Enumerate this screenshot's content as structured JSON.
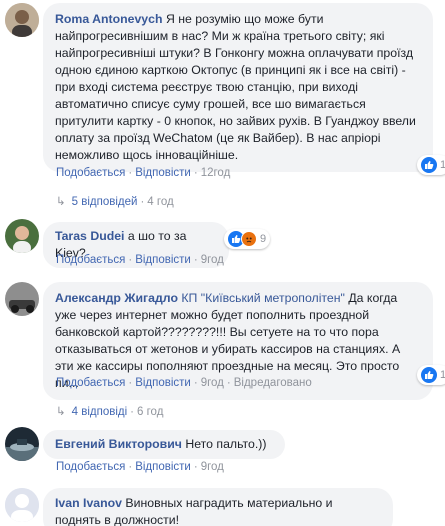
{
  "comments": [
    {
      "author": "Roma Antonevych",
      "text": "Я не розумію що може бути найпрогресивнішим в нас? Ми ж країна третього світу; які найпрогресивніші штуки? В Гонконгу можна оплачувати проїзд одною єдиною карткою Октопус (в принципі як і все на світі) - при вході система реєструє твою станцію, при виході автоматично списує суму грошей, все шо вимагається притулити картку - 0 кнопок, но зайвих рухів. В Гуанджоу ввели оплату за проїзд WeChatом (це як Вайбер). В нас апріорі неможливо щось інноваційніше.",
      "like": "Подобається",
      "reply": "Відповісти",
      "time": "12год",
      "reaction_count": "1",
      "replies_label": "5 відповідей",
      "replies_time": "4 год"
    },
    {
      "author": "Taras Dudei",
      "text": "а шо то за Kiev?",
      "like": "Подобається",
      "reply": "Відповісти",
      "time": "9год",
      "reaction_count": "9"
    },
    {
      "author": "Александр Жигадло",
      "mention": "КП \"Київський метрополітен\"",
      "text": " Да когда уже через интернет можно будет пополнить проездной банковской картой????????!!! Вы сетуете на то что пора отказываться от жетонов и убирать кассиров на станциях. А эти же кассиры пополняют проездные на месяц. Это просто пи...",
      "like": "Подобається",
      "reply": "Відповісти",
      "time": "9год",
      "edited": "Відредаговано",
      "reaction_count": "1",
      "replies_label": "4 відповіді",
      "replies_time": "6 год"
    },
    {
      "author": "Евгений Викторович",
      "text": "Нето пальто.))",
      "like": "Подобається",
      "reply": "Відповісти",
      "time": "9год"
    },
    {
      "author": "Ivan Ivanov",
      "text": "Виновных наградить материально и поднять в должности!"
    }
  ],
  "colors": {
    "link": "#385898",
    "action": "#4267b2",
    "meta": "#90949c",
    "bubble": "#f2f3f5",
    "like": "#1877f2",
    "angry": "#e9710f"
  },
  "icons": {
    "like": "like-reaction-icon",
    "angry": "angry-reaction-icon",
    "reply_arrow": "reply-arrow-icon"
  }
}
